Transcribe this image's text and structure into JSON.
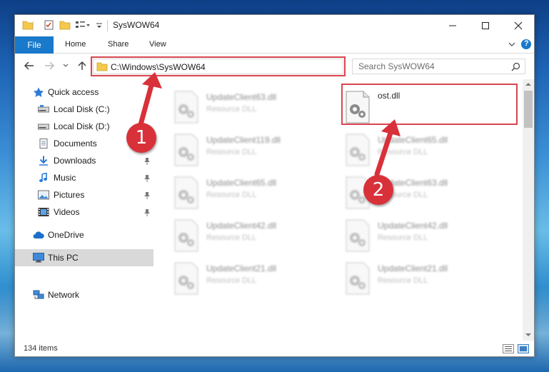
{
  "window": {
    "title": "SysWOW64",
    "minimize_glyph": "—",
    "maximize_glyph": "☐",
    "close_glyph": "✕"
  },
  "ribbon": {
    "tabs": [
      {
        "label": "File"
      },
      {
        "label": "Home"
      },
      {
        "label": "Share"
      },
      {
        "label": "View"
      }
    ],
    "help_glyph": "?"
  },
  "address": {
    "path": "C:\\Windows\\SysWOW64",
    "search_placeholder": "Search SysWOW64"
  },
  "navigation": {
    "items": [
      {
        "label": "Quick access",
        "icon": "star-icon",
        "pinned": false
      },
      {
        "label": "Local Disk (C:)",
        "icon": "drive-icon",
        "pinned": false
      },
      {
        "label": "Local Disk (D:)",
        "icon": "drive-icon",
        "pinned": false
      },
      {
        "label": "Documents",
        "icon": "documents-icon",
        "pinned": false
      },
      {
        "label": "Downloads",
        "icon": "download-arrow-icon",
        "pinned": true
      },
      {
        "label": "Music",
        "icon": "music-note-icon",
        "pinned": true
      },
      {
        "label": "Pictures",
        "icon": "picture-icon",
        "pinned": true
      },
      {
        "label": "Videos",
        "icon": "film-icon",
        "pinned": true
      },
      {
        "label": "OneDrive",
        "icon": "cloud-icon",
        "pinned": false
      },
      {
        "label": "This PC",
        "icon": "monitor-icon",
        "pinned": false,
        "selected": true
      },
      {
        "label": "Network",
        "icon": "network-icon",
        "pinned": false
      }
    ]
  },
  "files": {
    "left_column": [
      {
        "name": "UpdateClient63.dll",
        "type": "Resource DLL"
      },
      {
        "name": "UpdateClient119.dll",
        "type": "Resource DLL"
      },
      {
        "name": "UpdateClient65.dll",
        "type": "Resource DLL"
      },
      {
        "name": "UpdateClient42.dll",
        "type": "Resource DLL"
      },
      {
        "name": "UpdateClient21.dll",
        "type": "Resource DLL"
      }
    ],
    "right_column": [
      {
        "name": "ost.dll",
        "type": ""
      },
      {
        "name": "UpdateClient65.dll",
        "type": "Resource DLL"
      },
      {
        "name": "UpdateClient63.dll",
        "type": "Resource DLL"
      },
      {
        "name": "UpdateClient42.dll",
        "type": "Resource DLL"
      },
      {
        "name": "UpdateClient21.dll",
        "type": "Resource DLL"
      }
    ]
  },
  "status": {
    "item_count": "134 items"
  },
  "annotations": {
    "step1": "1",
    "step2": "2",
    "color": "#d8313a"
  },
  "colors": {
    "file_tab": "#1979ca",
    "selected_nav": "#d9d9d9",
    "highlight": "#d9454f"
  }
}
